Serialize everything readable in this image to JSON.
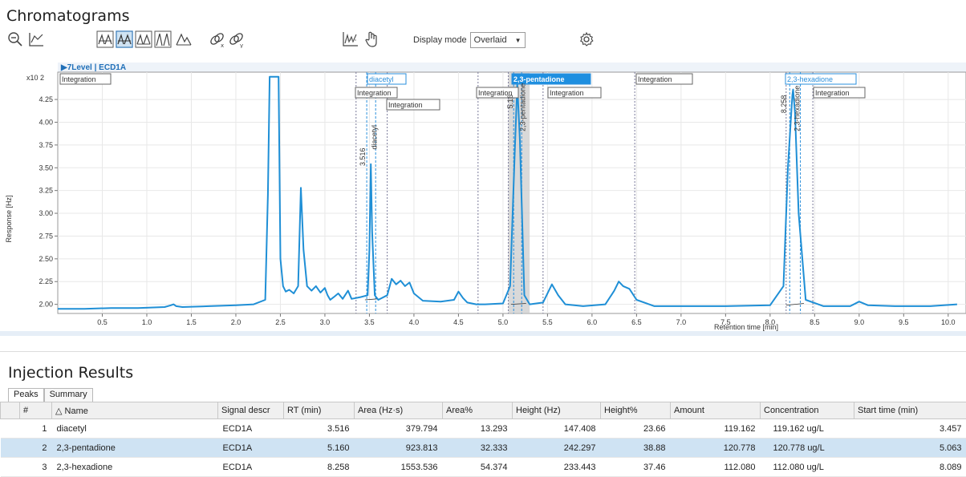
{
  "chromatograms_title": "Chromatograms",
  "toolbar": {
    "display_mode_label": "Display mode",
    "display_mode_value": "Overlaid",
    "icons": [
      "zoom-out-icon",
      "zoom-extent-icon",
      "peak-label-icon",
      "peak-label-active-icon",
      "peak-integration-icon",
      "peak-labels-vertical-icon",
      "baseline-icon",
      "link-x-icon",
      "link-y-icon",
      "chart-overlay-icon",
      "hand-tool-icon",
      "settings-gear-icon"
    ]
  },
  "chart_data": {
    "type": "line",
    "panel_label": "▶7Level | ECD1A",
    "xlabel": "Retention time [min]",
    "ylabel": "Response [Hz]",
    "y_multiplier": "x10 2",
    "xlim": [
      0,
      10.2
    ],
    "ylim": [
      1.9,
      4.55
    ],
    "xticks": [
      "0.5",
      "1.0",
      "1.5",
      "2.0",
      "2.5",
      "3.0",
      "3.5",
      "4.0",
      "4.5",
      "5.0",
      "5.5",
      "6.0",
      "6.5",
      "7.0",
      "7.5",
      "8.0",
      "8.5",
      "9.0",
      "9.5",
      "10.0"
    ],
    "yticks": [
      "2.00",
      "2.25",
      "2.50",
      "2.75",
      "3.00",
      "3.25",
      "3.50",
      "3.75",
      "4.00",
      "4.25"
    ],
    "grid": true,
    "series": [
      {
        "color": "#1f8fd6",
        "x": [
          0.0,
          0.3,
          0.6,
          0.9,
          1.2,
          1.27,
          1.3,
          1.33,
          1.4,
          1.7,
          2.0,
          2.2,
          2.33,
          2.36,
          2.38,
          2.42,
          2.46,
          2.48,
          2.5,
          2.53,
          2.56,
          2.6,
          2.65,
          2.7,
          2.73,
          2.76,
          2.8,
          2.85,
          2.9,
          2.95,
          3.0,
          3.03,
          3.06,
          3.1,
          3.15,
          3.2,
          3.26,
          3.3,
          3.4,
          3.48,
          3.5,
          3.516,
          3.53,
          3.56,
          3.6,
          3.7,
          3.75,
          3.8,
          3.85,
          3.9,
          3.95,
          4.0,
          4.1,
          4.3,
          4.45,
          4.5,
          4.55,
          4.6,
          4.7,
          4.8,
          5.0,
          5.08,
          5.13,
          5.16,
          5.19,
          5.24,
          5.3,
          5.45,
          5.55,
          5.62,
          5.7,
          5.9,
          6.15,
          6.25,
          6.3,
          6.35,
          6.42,
          6.5,
          6.7,
          7.0,
          7.5,
          8.0,
          8.15,
          8.2,
          8.25,
          8.258,
          8.28,
          8.32,
          8.4,
          8.6,
          8.9,
          9.0,
          9.1,
          9.4,
          9.8,
          10.1
        ],
        "y": [
          1.95,
          1.95,
          1.96,
          1.96,
          1.97,
          1.99,
          2.0,
          1.98,
          1.97,
          1.98,
          1.99,
          2.0,
          2.05,
          3.2,
          4.5,
          4.5,
          4.5,
          4.5,
          2.5,
          2.2,
          2.14,
          2.16,
          2.12,
          2.2,
          3.28,
          2.6,
          2.2,
          2.15,
          2.2,
          2.13,
          2.18,
          2.1,
          2.05,
          2.08,
          2.12,
          2.06,
          2.15,
          2.06,
          2.08,
          2.1,
          2.6,
          3.54,
          2.8,
          2.1,
          2.05,
          2.1,
          2.28,
          2.22,
          2.26,
          2.2,
          2.24,
          2.12,
          2.04,
          2.03,
          2.05,
          2.14,
          2.07,
          2.02,
          2.0,
          2.0,
          2.01,
          2.2,
          3.6,
          4.42,
          3.8,
          2.1,
          2.0,
          2.02,
          2.22,
          2.1,
          2.0,
          1.98,
          2.0,
          2.15,
          2.25,
          2.2,
          2.17,
          2.05,
          1.98,
          1.98,
          1.98,
          1.99,
          2.2,
          3.5,
          4.3,
          4.36,
          4.1,
          3.0,
          2.05,
          1.98,
          1.98,
          2.03,
          1.99,
          1.98,
          1.98,
          2.0
        ]
      }
    ],
    "annotations": [
      "Integration",
      "diacetyl",
      "Integration",
      "Integration",
      "Integration",
      "2,3-pentadione",
      "Integration",
      "Integration",
      "2,3-hexadione",
      "Integration",
      "3.516",
      "diacetyl",
      "5.16",
      "2,3-pentadione",
      "8.258",
      "2,3-hexadione"
    ]
  },
  "results": {
    "title": "Injection Results",
    "tabs": [
      "Peaks",
      "Summary"
    ],
    "columns": [
      "#",
      "Name",
      "Signal descr",
      "RT (min)",
      "Area (Hz·s)",
      "Area%",
      "Height (Hz)",
      "Height%",
      "Amount",
      "Concentration",
      "Start time (min)"
    ],
    "rows": [
      {
        "n": "1",
        "name": "diacetyl",
        "signal": "ECD1A",
        "rt": "3.516",
        "area": "379.794",
        "area_pct": "13.293",
        "height": "147.408",
        "height_pct": "23.66",
        "amount": "119.162",
        "conc": "119.162 ug/L",
        "start": "3.457"
      },
      {
        "n": "2",
        "name": "2,3-pentadione",
        "signal": "ECD1A",
        "rt": "5.160",
        "area": "923.813",
        "area_pct": "32.333",
        "height": "242.297",
        "height_pct": "38.88",
        "amount": "120.778",
        "conc": "120.778 ug/L",
        "start": "5.063"
      },
      {
        "n": "3",
        "name": "2,3-hexadione",
        "signal": "ECD1A",
        "rt": "8.258",
        "area": "1553.536",
        "area_pct": "54.374",
        "height": "233.443",
        "height_pct": "37.46",
        "amount": "112.080",
        "conc": "112.080 ug/L",
        "start": "8.089"
      }
    ]
  }
}
